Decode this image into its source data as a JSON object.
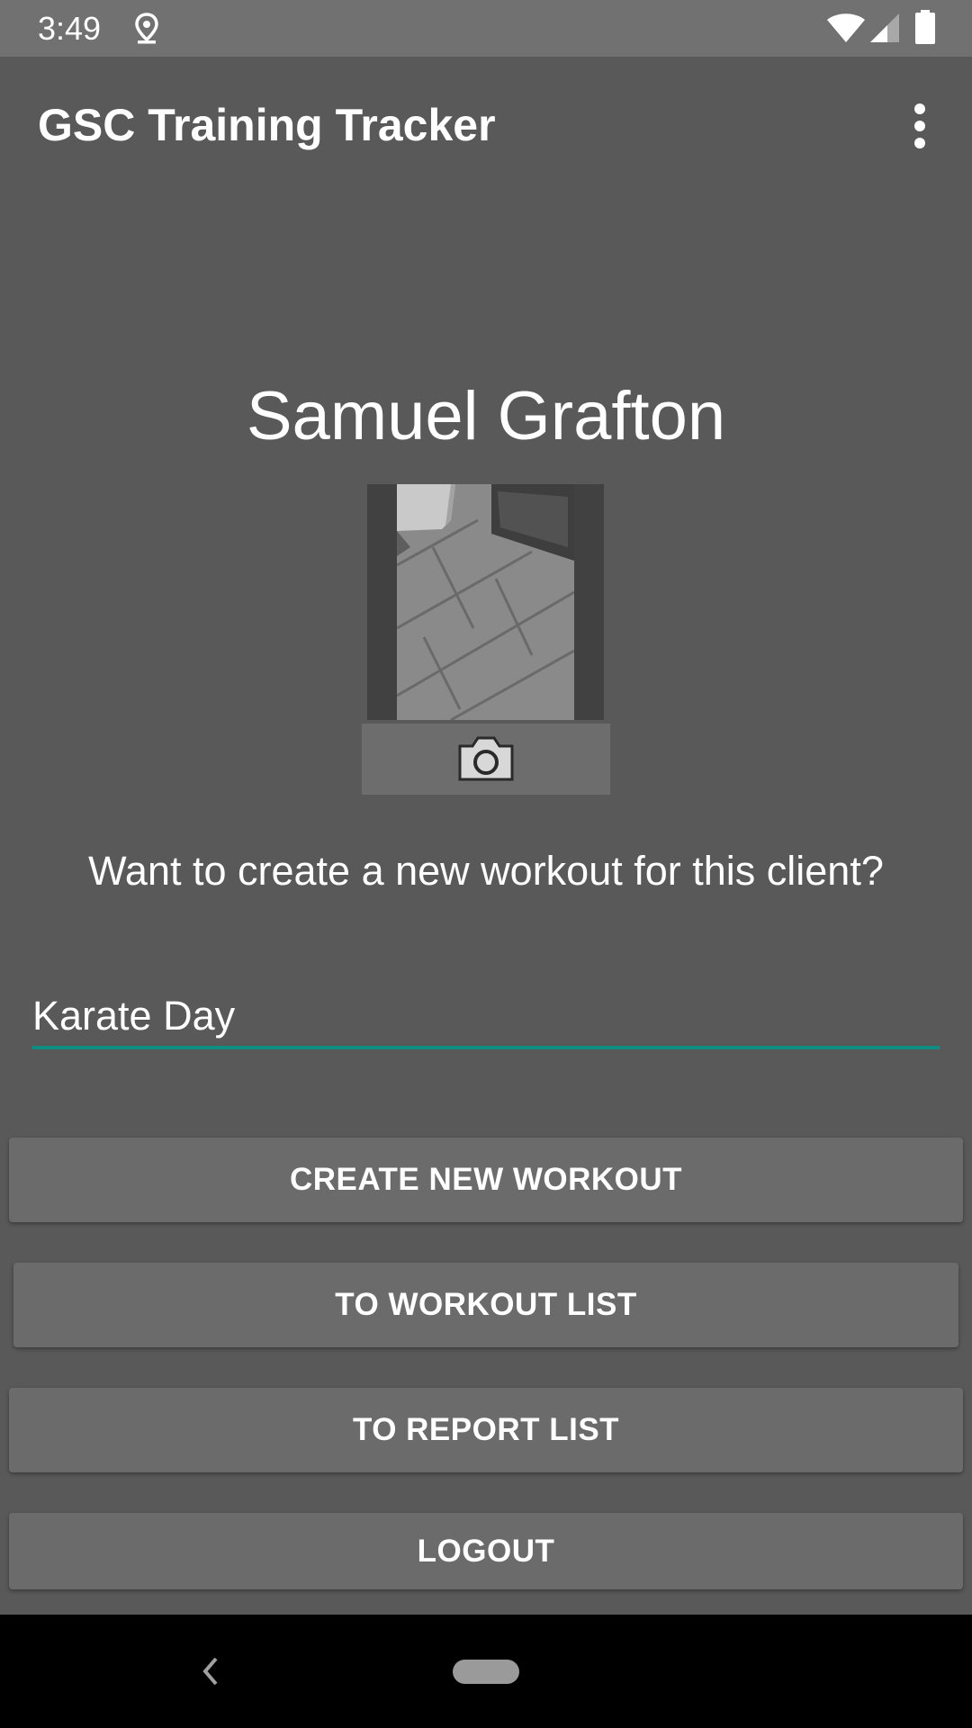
{
  "status_bar": {
    "time": "3:49",
    "icons": [
      "location-icon",
      "wifi-icon",
      "signal-icon",
      "battery-icon"
    ]
  },
  "app_bar": {
    "title": "GSC Training Tracker",
    "menu_icon": "overflow-menu-icon"
  },
  "client": {
    "name": "Samuel Grafton",
    "camera_icon": "camera-icon"
  },
  "prompt": "Want to create a new workout for this client?",
  "workout_input": {
    "value": "Karate Day"
  },
  "buttons": {
    "create": "CREATE NEW WORKOUT",
    "workout_list": "TO WORKOUT LIST",
    "report_list": "TO REPORT LIST",
    "logout": "LOGOUT"
  },
  "colors": {
    "background": "#595959",
    "status_bar": "#717171",
    "accent": "#0e8d85",
    "button": "#6b6b6b"
  },
  "nav_bar": {
    "icons": [
      "back-icon",
      "home-pill-icon"
    ]
  }
}
